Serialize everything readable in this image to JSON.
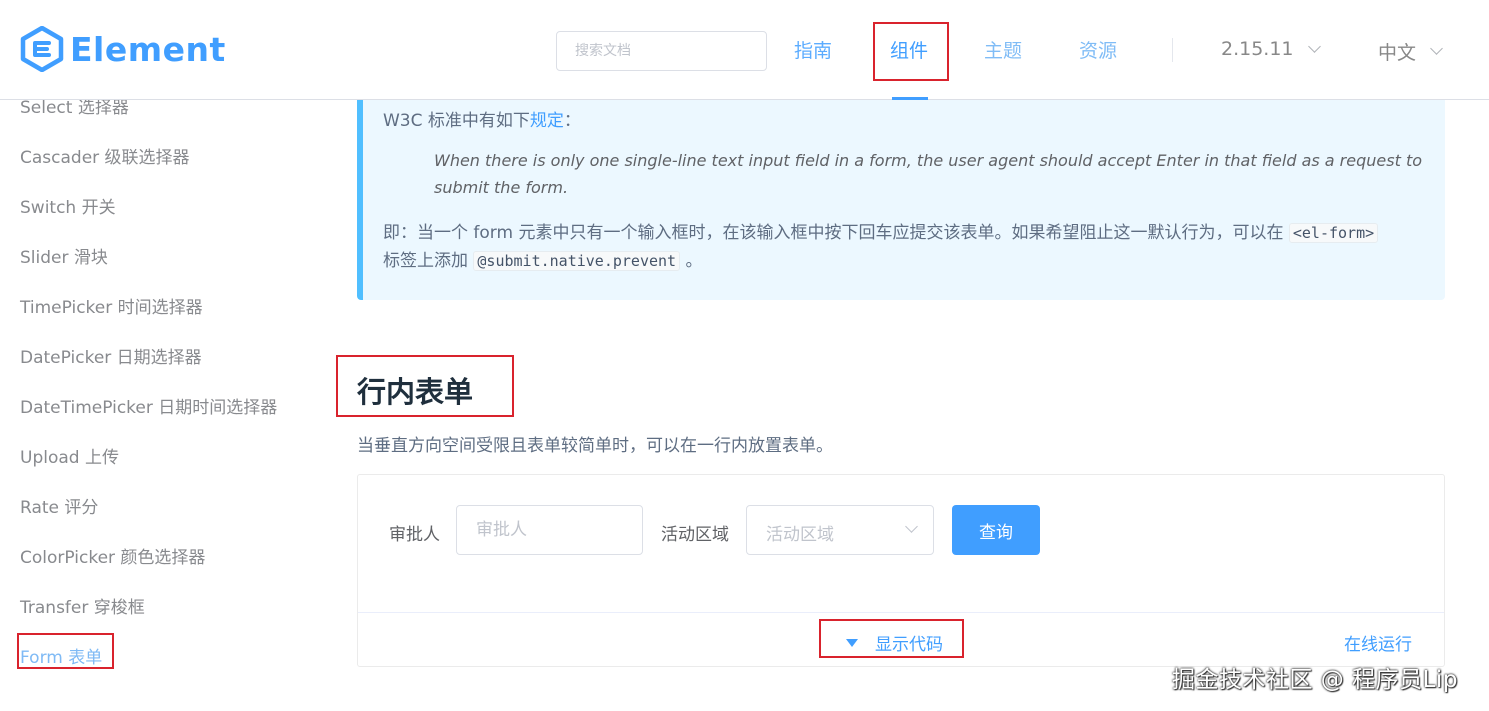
{
  "header": {
    "logo_text": "Element",
    "search_placeholder": "搜索文档",
    "nav": {
      "guide": "指南",
      "component": "组件",
      "theme": "主题",
      "resource": "资源"
    },
    "version": "2.15.11",
    "language": "中文"
  },
  "sidebar": {
    "items": [
      "Select 选择器",
      "Cascader 级联选择器",
      "Switch 开关",
      "Slider 滑块",
      "TimePicker 时间选择器",
      "DatePicker 日期选择器",
      "DateTimePicker 日期时间选择器",
      "Upload 上传",
      "Rate 评分",
      "ColorPicker 颜色选择器",
      "Transfer 穿梭框",
      "Form 表单"
    ]
  },
  "tip": {
    "line1_prefix": "W3C 标准中有如下",
    "line1_link": "规定",
    "line1_suffix": "：",
    "quote": "When there is only one single-line text input field in a form, the user agent should accept Enter in that field as a request to submit the form.",
    "body_prefix": "即：当一个 form 元素中只有一个输入框时，在该输入框中按下回车应提交该表单。如果希望阻止这一默认行为，可以在",
    "body_code1": "<el-form>",
    "body_mid": "标签上添加",
    "body_code2": "@submit.native.prevent",
    "body_suffix": "。"
  },
  "section": {
    "title": "行内表单",
    "description": "当垂直方向空间受限且表单较简单时，可以在一行内放置表单。"
  },
  "demo": {
    "approver_label": "审批人",
    "approver_placeholder": "审批人",
    "region_label": "活动区域",
    "region_placeholder": "活动区域",
    "query_button": "查询",
    "show_code": "显示代码",
    "run_online": "在线运行"
  },
  "watermark": "掘金技术社区 @ 程序员Lip",
  "colors": {
    "primary": "#409eff",
    "highlight_box": "#d9232d",
    "tip_bg": "#ecf8ff",
    "tip_border": "#50bfff"
  }
}
